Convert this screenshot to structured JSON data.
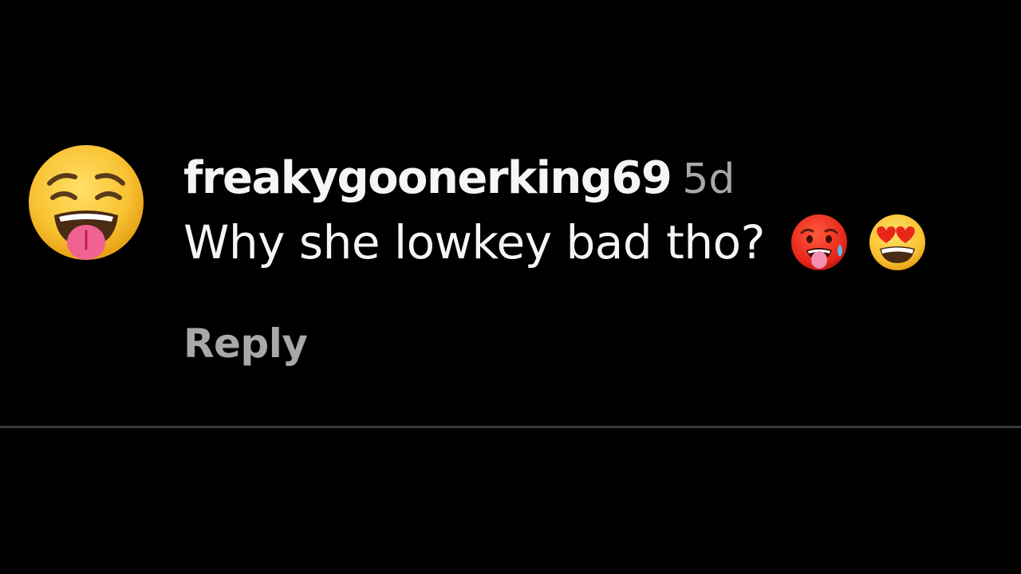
{
  "comment": {
    "avatar_icon": "weary-face-tongue-out-emoji-icon",
    "username": "freakygoonerking69",
    "timestamp": "5d",
    "text": "Why she lowkey bad tho?",
    "emojis": [
      "hot-face-emoji-icon",
      "smiling-face-heart-eyes-emoji-icon"
    ],
    "reply_label": "Reply"
  },
  "colors": {
    "background": "#000000",
    "primary_text": "#f5f5f5",
    "secondary_text": "#a8a8a8",
    "divider": "#3a3a3a"
  }
}
